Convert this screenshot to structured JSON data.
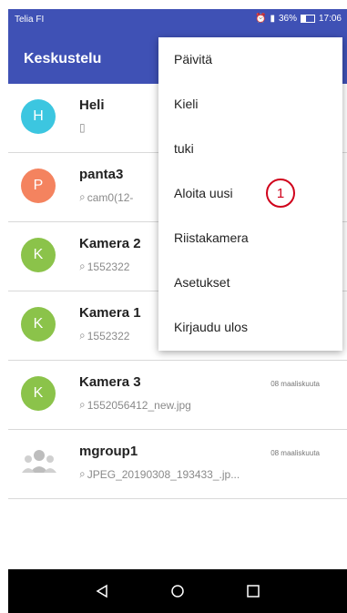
{
  "status_bar": {
    "carrier": "Telia FI",
    "battery": "36%",
    "time": "17:06"
  },
  "app_bar": {
    "title": "Keskustelu"
  },
  "menu": {
    "items": [
      "Päivitä",
      "Kieli",
      "tuki",
      "Aloita uusi",
      "Riistakamera",
      "Asetukset",
      "Kirjaudu ulos"
    ],
    "annotation_label": "1"
  },
  "conversations": [
    {
      "name": "Heli",
      "initial": "H",
      "preview": "▯",
      "date": "",
      "avatar_color": "#3cc6e0"
    },
    {
      "name": "panta3",
      "initial": "P",
      "preview": "cam0(12-",
      "date": "",
      "avatar_color": "#f4835f"
    },
    {
      "name": "Kamera 2",
      "initial": "K",
      "preview": "1552322",
      "date": "",
      "avatar_color": "#8bc34a"
    },
    {
      "name": "Kamera 1",
      "initial": "K",
      "preview": "1552322",
      "date": "",
      "avatar_color": "#8bc34a"
    },
    {
      "name": "Kamera 3",
      "initial": "K",
      "preview": "1552056412_new.jpg",
      "date": "08 maaliskuuta",
      "avatar_color": "#8bc34a"
    },
    {
      "name": "mgroup1",
      "initial": "",
      "preview": "JPEG_20190308_193433_.jp...",
      "date": "08 maaliskuuta",
      "avatar_color": "#bdbdbd"
    }
  ],
  "colors": {
    "primary": "#3f51b5",
    "annotation": "#d0021b"
  },
  "icons": {
    "back": "back-icon",
    "home": "home-icon",
    "recents": "recents-icon",
    "attachment": "paperclip-icon"
  }
}
